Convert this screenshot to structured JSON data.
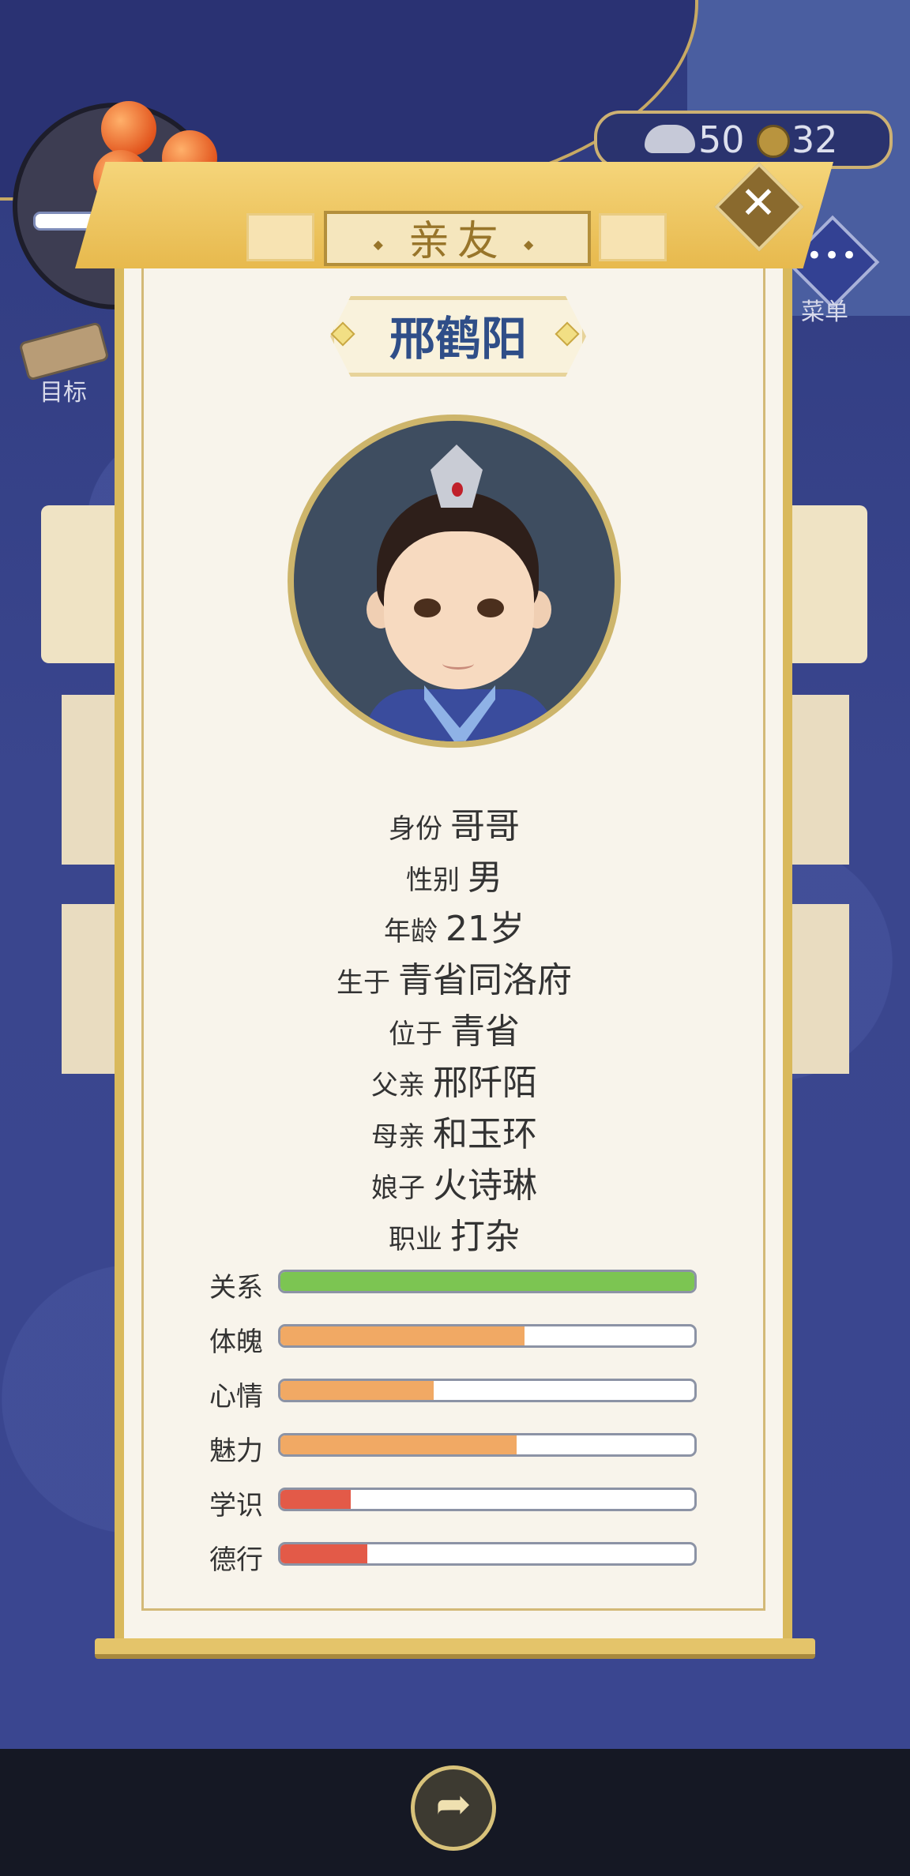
{
  "top": {
    "goal_label": "目标",
    "menu_label": "菜单",
    "menu_dots": "•••",
    "silver_ingots": "50",
    "copper_coins": "32"
  },
  "panel": {
    "title": "亲友",
    "close_symbol": "✕",
    "name": "邢鹤阳"
  },
  "info": [
    {
      "label": "身份",
      "value": "哥哥"
    },
    {
      "label": "性别",
      "value": "男"
    },
    {
      "label": "年龄",
      "value": "21岁"
    },
    {
      "label": "生于",
      "value": "青省同洛府"
    },
    {
      "label": "位于",
      "value": "青省"
    },
    {
      "label": "父亲",
      "value": "邢阡陌"
    },
    {
      "label": "母亲",
      "value": "和玉环"
    },
    {
      "label": "娘子",
      "value": "火诗琳"
    },
    {
      "label": "职业",
      "value": "打杂"
    }
  ],
  "stats": [
    {
      "label": "关系",
      "value": 1.0,
      "color": "#7cc552"
    },
    {
      "label": "体魄",
      "value": 0.59,
      "color": "#f1a964"
    },
    {
      "label": "心情",
      "value": 0.37,
      "color": "#f1a964"
    },
    {
      "label": "魅力",
      "value": 0.57,
      "color": "#f1a964"
    },
    {
      "label": "学识",
      "value": 0.17,
      "color": "#e35a48"
    },
    {
      "label": "德行",
      "value": 0.21,
      "color": "#e35a48"
    }
  ],
  "bottom": {
    "share_icon": "share-icon"
  }
}
